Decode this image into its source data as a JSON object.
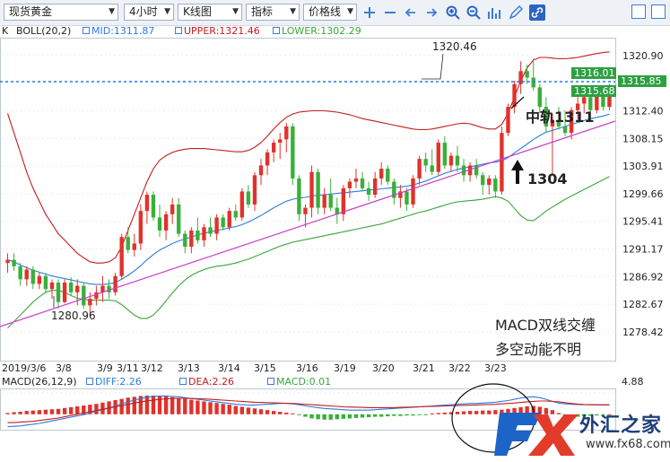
{
  "toolbar": {
    "product": "现货黄金",
    "period": "4小时",
    "chart_type": "K线图",
    "indicator": "指标",
    "price_line": "价格线",
    "icons": [
      "add-icon",
      "remove-icon",
      "arrow-left-icon",
      "arrow-right-icon",
      "zoom-in-icon",
      "zoom-out-icon",
      "bar-chart-icon",
      "pencil-icon",
      "link-icon"
    ],
    "win_buttons": [
      "restore-icon",
      "maximize-icon"
    ]
  },
  "main_legend": {
    "k": "K",
    "boll": "BOLL(20,2)",
    "mid": "MID:1311.87",
    "upper": "UPPER:1321.46",
    "lower": "LOWER:1302.29"
  },
  "macd_legend": {
    "macd": "MACD(26,12,9)",
    "diff": "DIFF:2.26",
    "dea": "DEA:2.26",
    "macd_val": "MACD:0.01",
    "axis_value": "4.88"
  },
  "annotations": {
    "high_label": "1320.46",
    "low_label": "1280.96",
    "mid_track": "中轨1311",
    "support": "1304",
    "comment_line1": "MACD双线交缠",
    "comment_line2": "多空动能不明"
  },
  "price_tags": {
    "tag_green_top": "1316.01",
    "tag_green_bottom": "1315.68",
    "tag_last": "1315.85"
  },
  "logo": {
    "fx": "FX",
    "cn": "外汇之家",
    "url": "www.fx68.com"
  },
  "colors": {
    "up": "#e0322b",
    "down": "#38b03a",
    "mid": "#2a7de1",
    "upper": "#c61c1c",
    "lower": "#3aa63a",
    "trend": "#c93ecb",
    "diff_line": "#2a7de1",
    "dea_line": "#c61c1c",
    "hline": "#2a7de1"
  },
  "chart_data": [
    {
      "type": "candlestick",
      "title": "现货黄金 4小时",
      "x_labels": [
        "2019/3/6",
        "3/8",
        "3/9",
        "3/11",
        "3/12",
        "3/13",
        "3/14",
        "3/15",
        "3/16",
        "3/19",
        "3/20",
        "3/21",
        "3/22",
        "3/23"
      ],
      "y_ticks": [
        1320.9,
        1316.85,
        1312.4,
        1308.15,
        1303.91,
        1299.66,
        1295.41,
        1291.17,
        1286.92,
        1282.67,
        1278.42
      ],
      "ylim": [
        1274.0,
        1323.5
      ],
      "candles": [
        [
          1289.0,
          1290.5,
          1287.5,
          1289.5
        ],
        [
          1289.5,
          1290.5,
          1287.8,
          1288.5
        ],
        [
          1288.5,
          1289.0,
          1285.5,
          1286.5
        ],
        [
          1286.5,
          1288.5,
          1285.5,
          1288.0
        ],
        [
          1288.0,
          1288.5,
          1285.0,
          1285.8
        ],
        [
          1285.8,
          1287.5,
          1285.0,
          1287.0
        ],
        [
          1287.0,
          1287.5,
          1284.5,
          1285.0
        ],
        [
          1285.0,
          1286.5,
          1283.5,
          1286.0
        ],
        [
          1286.0,
          1286.5,
          1282.0,
          1283.0
        ],
        [
          1283.0,
          1286.5,
          1282.8,
          1286.0
        ],
        [
          1286.0,
          1286.8,
          1284.0,
          1284.5
        ],
        [
          1284.5,
          1286.5,
          1282.5,
          1285.5
        ],
        [
          1285.5,
          1286.0,
          1282.0,
          1282.5
        ],
        [
          1282.5,
          1284.5,
          1280.96,
          1283.5
        ],
        [
          1283.5,
          1285.5,
          1282.5,
          1284.5
        ],
        [
          1284.5,
          1287.0,
          1283.0,
          1285.5
        ],
        [
          1285.5,
          1286.5,
          1283.5,
          1284.5
        ],
        [
          1284.5,
          1287.5,
          1284.0,
          1287.0
        ],
        [
          1287.0,
          1293.5,
          1286.5,
          1293.0
        ],
        [
          1293.0,
          1294.5,
          1290.5,
          1291.0
        ],
        [
          1291.0,
          1293.5,
          1290.0,
          1292.0
        ],
        [
          1292.0,
          1298.0,
          1291.0,
          1297.0
        ],
        [
          1297.0,
          1300.0,
          1295.0,
          1299.5
        ],
        [
          1299.5,
          1300.0,
          1295.5,
          1296.0
        ],
        [
          1296.0,
          1298.0,
          1293.0,
          1294.0
        ],
        [
          1294.0,
          1297.0,
          1292.5,
          1296.5
        ],
        [
          1296.5,
          1299.0,
          1295.0,
          1298.0
        ],
        [
          1298.0,
          1299.0,
          1293.0,
          1293.5
        ],
        [
          1293.5,
          1294.0,
          1290.5,
          1291.5
        ],
        [
          1291.5,
          1294.5,
          1290.5,
          1294.0
        ],
        [
          1294.0,
          1296.0,
          1292.0,
          1292.5
        ],
        [
          1292.5,
          1295.0,
          1291.5,
          1294.5
        ],
        [
          1294.5,
          1296.0,
          1293.0,
          1293.5
        ],
        [
          1293.5,
          1296.5,
          1292.5,
          1296.0
        ],
        [
          1296.0,
          1296.5,
          1294.0,
          1294.5
        ],
        [
          1294.5,
          1297.5,
          1294.0,
          1297.0
        ],
        [
          1297.0,
          1298.0,
          1295.5,
          1296.0
        ],
        [
          1296.0,
          1300.5,
          1295.5,
          1300.0
        ],
        [
          1300.0,
          1301.0,
          1297.5,
          1298.0
        ],
        [
          1298.0,
          1303.0,
          1297.0,
          1302.5
        ],
        [
          1302.5,
          1305.0,
          1301.0,
          1304.0
        ],
        [
          1304.0,
          1306.5,
          1302.5,
          1306.0
        ],
        [
          1306.0,
          1308.0,
          1304.5,
          1307.5
        ],
        [
          1307.5,
          1309.0,
          1305.0,
          1308.0
        ],
        [
          1308.0,
          1310.5,
          1306.0,
          1310.0
        ],
        [
          1310.0,
          1310.5,
          1301.0,
          1302.0
        ],
        [
          1302.0,
          1302.5,
          1295.5,
          1296.5
        ],
        [
          1296.5,
          1298.0,
          1294.5,
          1297.5
        ],
        [
          1297.5,
          1304.0,
          1296.0,
          1303.0
        ],
        [
          1303.0,
          1303.5,
          1296.5,
          1297.5
        ],
        [
          1297.5,
          1300.5,
          1296.5,
          1299.5
        ],
        [
          1299.5,
          1302.0,
          1297.0,
          1297.5
        ],
        [
          1297.5,
          1299.0,
          1295.0,
          1296.5
        ],
        [
          1296.5,
          1301.0,
          1295.5,
          1300.5
        ],
        [
          1300.5,
          1302.0,
          1299.0,
          1301.5
        ],
        [
          1301.5,
          1303.5,
          1300.5,
          1302.0
        ],
        [
          1302.0,
          1303.0,
          1300.0,
          1300.5
        ],
        [
          1300.5,
          1301.5,
          1298.5,
          1299.5
        ],
        [
          1299.5,
          1303.0,
          1299.0,
          1302.0
        ],
        [
          1302.0,
          1304.5,
          1301.0,
          1303.5
        ],
        [
          1303.5,
          1304.0,
          1301.0,
          1301.5
        ],
        [
          1301.5,
          1302.0,
          1298.0,
          1299.0
        ],
        [
          1299.0,
          1301.0,
          1297.5,
          1300.0
        ],
        [
          1300.0,
          1300.5,
          1297.0,
          1298.0
        ],
        [
          1298.0,
          1302.5,
          1297.5,
          1302.0
        ],
        [
          1302.0,
          1305.5,
          1301.0,
          1305.0
        ],
        [
          1305.0,
          1306.0,
          1303.0,
          1304.0
        ],
        [
          1304.0,
          1306.5,
          1302.5,
          1303.0
        ],
        [
          1303.0,
          1308.0,
          1302.5,
          1307.5
        ],
        [
          1307.5,
          1308.5,
          1303.5,
          1304.0
        ],
        [
          1304.0,
          1306.0,
          1303.0,
          1305.5
        ],
        [
          1305.5,
          1307.0,
          1303.0,
          1304.0
        ],
        [
          1304.0,
          1305.0,
          1301.5,
          1302.5
        ],
        [
          1302.5,
          1304.5,
          1301.5,
          1304.0
        ],
        [
          1304.0,
          1305.0,
          1302.0,
          1302.5
        ],
        [
          1302.5,
          1303.0,
          1299.5,
          1301.0
        ],
        [
          1301.0,
          1302.5,
          1299.5,
          1302.0
        ],
        [
          1302.0,
          1302.5,
          1299.0,
          1300.0
        ],
        [
          1300.0,
          1310.0,
          1299.5,
          1309.0
        ],
        [
          1309.0,
          1313.5,
          1308.5,
          1313.0
        ],
        [
          1313.0,
          1317.0,
          1312.0,
          1316.5
        ],
        [
          1316.5,
          1320.0,
          1315.0,
          1318.5
        ],
        [
          1318.5,
          1319.5,
          1316.5,
          1317.5
        ],
        [
          1317.5,
          1320.46,
          1315.5,
          1316.0
        ],
        [
          1316.0,
          1316.5,
          1312.0,
          1313.0
        ],
        [
          1313.0,
          1314.5,
          1309.0,
          1310.0
        ],
        [
          1310.0,
          1312.0,
          1302.5,
          1311.0
        ],
        [
          1311.0,
          1313.0,
          1309.5,
          1310.0
        ],
        [
          1310.0,
          1312.5,
          1308.5,
          1309.0
        ],
        [
          1309.0,
          1313.0,
          1308.0,
          1312.5
        ],
        [
          1312.5,
          1314.5,
          1311.0,
          1313.5
        ],
        [
          1313.5,
          1315.0,
          1312.0,
          1314.5
        ],
        [
          1314.5,
          1315.0,
          1312.0,
          1312.5
        ],
        [
          1312.5,
          1315.5,
          1312.0,
          1315.0
        ],
        [
          1315.0,
          1315.5,
          1312.5,
          1313.0
        ],
        [
          1313.0,
          1316.5,
          1312.5,
          1315.85
        ]
      ],
      "mid": [
        1289.5,
        1289.2,
        1288.7,
        1288.3,
        1287.9,
        1287.6,
        1287.3,
        1287.0,
        1286.8,
        1286.6,
        1286.4,
        1286.2,
        1286.0,
        1285.8,
        1285.7,
        1285.7,
        1285.8,
        1286.0,
        1286.5,
        1287.1,
        1287.8,
        1288.6,
        1289.5,
        1290.3,
        1291.0,
        1291.5,
        1292.0,
        1292.4,
        1292.7,
        1293.0,
        1293.3,
        1293.6,
        1293.8,
        1294.0,
        1294.2,
        1294.4,
        1294.6,
        1294.9,
        1295.3,
        1295.8,
        1296.3,
        1296.9,
        1297.5,
        1298.0,
        1298.5,
        1298.8,
        1299.0,
        1299.1,
        1299.3,
        1299.4,
        1299.5,
        1299.6,
        1299.7,
        1299.8,
        1299.9,
        1300.0,
        1300.1,
        1300.2,
        1300.3,
        1300.4,
        1300.5,
        1300.6,
        1300.7,
        1300.8,
        1301.0,
        1301.3,
        1301.6,
        1302.0,
        1302.4,
        1302.8,
        1303.1,
        1303.4,
        1303.6,
        1303.8,
        1304.0,
        1304.2,
        1304.4,
        1304.5,
        1304.7,
        1305.2,
        1305.9,
        1306.6,
        1307.3,
        1308.0,
        1308.6,
        1309.1,
        1309.4,
        1309.7,
        1310.0,
        1310.3,
        1310.6,
        1310.9,
        1311.2,
        1311.4,
        1311.6,
        1311.87
      ],
      "upper": [
        1312.0,
        1309.0,
        1306.0,
        1303.0,
        1300.5,
        1298.5,
        1296.5,
        1295.0,
        1293.5,
        1292.5,
        1291.5,
        1290.5,
        1289.8,
        1289.2,
        1289.0,
        1289.0,
        1289.2,
        1289.8,
        1291.5,
        1294.0,
        1296.5,
        1299.0,
        1301.5,
        1303.5,
        1304.8,
        1305.5,
        1306.0,
        1306.3,
        1306.5,
        1306.6,
        1306.6,
        1306.6,
        1306.5,
        1306.4,
        1306.3,
        1306.2,
        1306.1,
        1306.1,
        1306.3,
        1306.8,
        1307.5,
        1308.5,
        1309.6,
        1310.6,
        1311.4,
        1311.9,
        1312.2,
        1312.3,
        1312.4,
        1312.4,
        1312.4,
        1312.3,
        1312.2,
        1312.0,
        1311.8,
        1311.5,
        1311.2,
        1311.0,
        1310.8,
        1310.6,
        1310.4,
        1310.2,
        1310.0,
        1309.8,
        1309.6,
        1309.5,
        1309.5,
        1309.6,
        1309.8,
        1310.0,
        1310.2,
        1310.4,
        1310.5,
        1310.4,
        1310.1,
        1309.8,
        1309.6,
        1309.6,
        1310.3,
        1312.0,
        1314.5,
        1317.0,
        1319.0,
        1320.2,
        1320.6,
        1320.6,
        1320.5,
        1320.4,
        1320.4,
        1320.5,
        1320.6,
        1320.8,
        1321.0,
        1321.2,
        1321.35,
        1321.46
      ],
      "lower": [
        1279.0,
        1280.0,
        1281.0,
        1282.0,
        1283.0,
        1283.8,
        1284.5,
        1284.8,
        1284.8,
        1284.5,
        1284.0,
        1283.6,
        1283.4,
        1283.3,
        1283.3,
        1283.3,
        1283.3,
        1283.2,
        1282.6,
        1281.8,
        1281.0,
        1280.5,
        1280.5,
        1281.0,
        1282.0,
        1283.2,
        1284.4,
        1285.5,
        1286.4,
        1287.1,
        1287.6,
        1288.0,
        1288.3,
        1288.5,
        1288.6,
        1288.8,
        1289.0,
        1289.3,
        1289.6,
        1290.0,
        1290.4,
        1290.8,
        1291.2,
        1291.6,
        1291.9,
        1292.2,
        1292.4,
        1292.6,
        1292.8,
        1293.0,
        1293.2,
        1293.4,
        1293.6,
        1293.8,
        1294.0,
        1294.2,
        1294.4,
        1294.6,
        1294.8,
        1295.0,
        1295.3,
        1295.6,
        1295.9,
        1296.2,
        1296.5,
        1296.8,
        1297.0,
        1297.3,
        1297.6,
        1297.9,
        1298.2,
        1298.4,
        1298.5,
        1298.6,
        1298.7,
        1298.8,
        1299.0,
        1299.2,
        1299.0,
        1298.5,
        1297.4,
        1296.3,
        1295.6,
        1295.5,
        1296.2,
        1297.0,
        1297.6,
        1298.2,
        1298.8,
        1299.3,
        1299.8,
        1300.3,
        1300.8,
        1301.3,
        1301.8,
        1302.29
      ]
    },
    {
      "type": "bar",
      "title": "MACD(26,12,9)",
      "ylim": [
        -3.5,
        6.0
      ],
      "y_ticks": [
        4.88
      ],
      "values": [
        0.3,
        0.5,
        0.6,
        0.8,
        0.9,
        1.0,
        1.1,
        1.2,
        1.3,
        1.5,
        1.7,
        1.9,
        2.1,
        2.3,
        2.5,
        2.8,
        3.1,
        3.4,
        3.7,
        4.0,
        4.2,
        4.4,
        4.5,
        4.5,
        4.4,
        4.3,
        4.1,
        3.9,
        3.7,
        3.5,
        3.3,
        3.1,
        2.9,
        2.7,
        2.5,
        2.3,
        2.0,
        1.8,
        1.6,
        1.4,
        1.2,
        1.0,
        0.8,
        0.6,
        0.4,
        0.2,
        -0.2,
        -0.6,
        -1.0,
        -1.2,
        -1.3,
        -1.3,
        -1.2,
        -1.1,
        -1.0,
        -0.9,
        -0.8,
        -0.7,
        -0.6,
        -0.6,
        -0.5,
        -0.4,
        -0.4,
        -0.3,
        -0.3,
        -0.2,
        -0.2,
        0.2,
        0.3,
        0.4,
        0.5,
        0.6,
        0.7,
        0.8,
        0.8,
        0.9,
        0.9,
        1.0,
        1.1,
        1.3,
        1.5,
        1.7,
        1.9,
        2.0,
        1.8,
        1.5,
        1.0,
        0.3,
        -0.3,
        -0.6,
        -0.6,
        -0.5,
        -0.4,
        -0.3,
        -0.2,
        0.01
      ],
      "diff": [
        -3.0,
        -2.9,
        -2.8,
        -2.6,
        -2.4,
        -2.2,
        -1.9,
        -1.6,
        -1.3,
        -1.0,
        -0.7,
        -0.4,
        -0.1,
        0.3,
        0.7,
        1.1,
        1.5,
        2.0,
        2.5,
        3.0,
        3.4,
        3.8,
        4.1,
        4.3,
        4.4,
        4.4,
        4.3,
        4.2,
        4.0,
        3.8,
        3.6,
        3.4,
        3.2,
        3.0,
        2.8,
        2.6,
        2.4,
        2.3,
        2.2,
        2.2,
        2.3,
        2.4,
        2.5,
        2.6,
        2.6,
        2.5,
        2.3,
        2.0,
        1.8,
        1.6,
        1.4,
        1.3,
        1.2,
        1.1,
        1.0,
        1.0,
        1.0,
        1.0,
        1.1,
        1.2,
        1.3,
        1.4,
        1.5,
        1.6,
        1.7,
        1.8,
        1.9,
        2.0,
        2.1,
        2.2,
        2.3,
        2.4,
        2.5,
        2.6,
        2.6,
        2.7,
        2.8,
        2.9,
        3.1,
        3.3,
        3.6,
        3.9,
        4.1,
        4.2,
        4.0,
        3.6,
        3.1,
        2.7,
        2.5,
        2.4,
        2.35,
        2.3,
        2.28,
        2.27,
        2.26,
        2.26
      ],
      "dea": [
        -2.0,
        -2.0,
        -1.9,
        -1.8,
        -1.7,
        -1.5,
        -1.3,
        -1.1,
        -0.9,
        -0.6,
        -0.3,
        0.0,
        0.3,
        0.6,
        0.9,
        1.2,
        1.5,
        1.8,
        2.1,
        2.4,
        2.7,
        3.0,
        3.2,
        3.4,
        3.6,
        3.7,
        3.8,
        3.85,
        3.85,
        3.8,
        3.75,
        3.7,
        3.6,
        3.5,
        3.4,
        3.3,
        3.2,
        3.1,
        3.0,
        2.9,
        2.85,
        2.8,
        2.75,
        2.7,
        2.65,
        2.6,
        2.5,
        2.4,
        2.3,
        2.2,
        2.1,
        2.0,
        1.9,
        1.8,
        1.75,
        1.7,
        1.65,
        1.6,
        1.6,
        1.6,
        1.6,
        1.6,
        1.65,
        1.7,
        1.75,
        1.8,
        1.85,
        1.9,
        1.95,
        2.0,
        2.05,
        2.1,
        2.15,
        2.2,
        2.25,
        2.3,
        2.35,
        2.4,
        2.5,
        2.6,
        2.7,
        2.85,
        3.0,
        3.1,
        3.2,
        3.2,
        3.1,
        3.0,
        2.8,
        2.6,
        2.45,
        2.35,
        2.3,
        2.28,
        2.27,
        2.26
      ]
    }
  ]
}
